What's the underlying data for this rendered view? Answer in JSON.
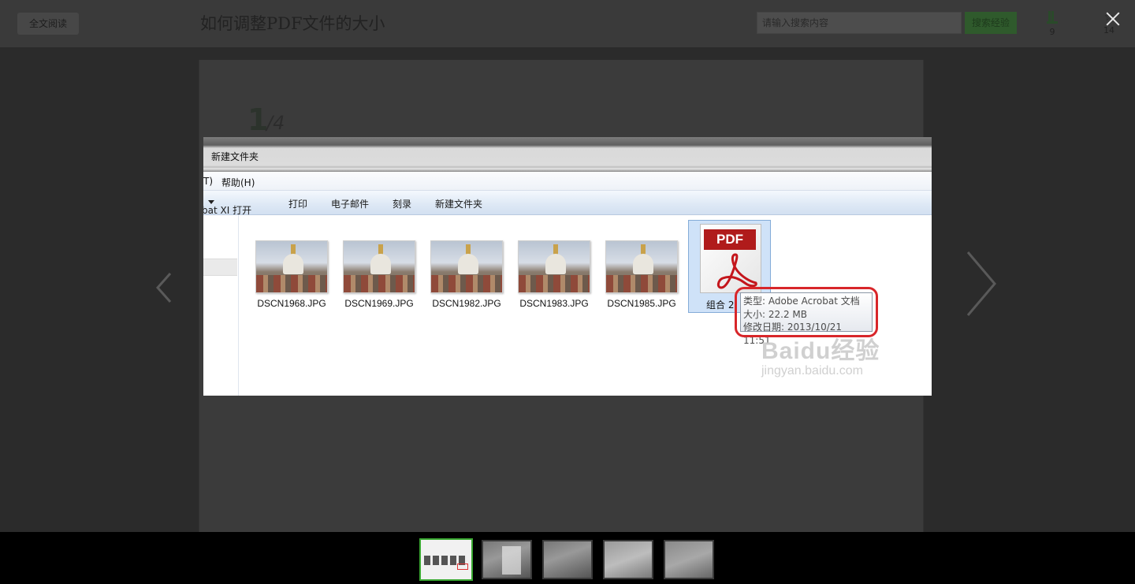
{
  "page": {
    "full_read_label": "全文阅读",
    "title": "如何调整PDF文件的大小",
    "search_placeholder": "请输入搜索内容",
    "search_button": "搜索经验",
    "vote_count": "9",
    "favorite_count": "14",
    "step_current": "1",
    "step_total": "/4"
  },
  "screenshot": {
    "window_title": "新建文件夹",
    "menu": [
      "T)",
      "帮助(H)"
    ],
    "toolbar": [
      "bat XI 打开",
      "打印",
      "电子邮件",
      "刻录",
      "新建文件夹"
    ],
    "files": [
      {
        "name": "DSCN1968.JPG"
      },
      {
        "name": "DSCN1969.JPG"
      },
      {
        "name": "DSCN1982.JPG"
      },
      {
        "name": "DSCN1983.JPG"
      },
      {
        "name": "DSCN1985.JPG"
      }
    ],
    "pdf_file": {
      "badge": "PDF",
      "label": "组合 2"
    },
    "tooltip": {
      "type": "类型: Adobe Acrobat 文档",
      "size": "大小: 22.2 MB",
      "modified": "修改日期: 2013/10/21 11:51"
    },
    "watermark": {
      "main": "Baidu经验",
      "sub": "jingyan.baidu.com"
    },
    "annotation_color": "#d8262a"
  },
  "thumbnails": {
    "count": 5,
    "active_index": 0,
    "active_border_color": "#3aa832"
  }
}
